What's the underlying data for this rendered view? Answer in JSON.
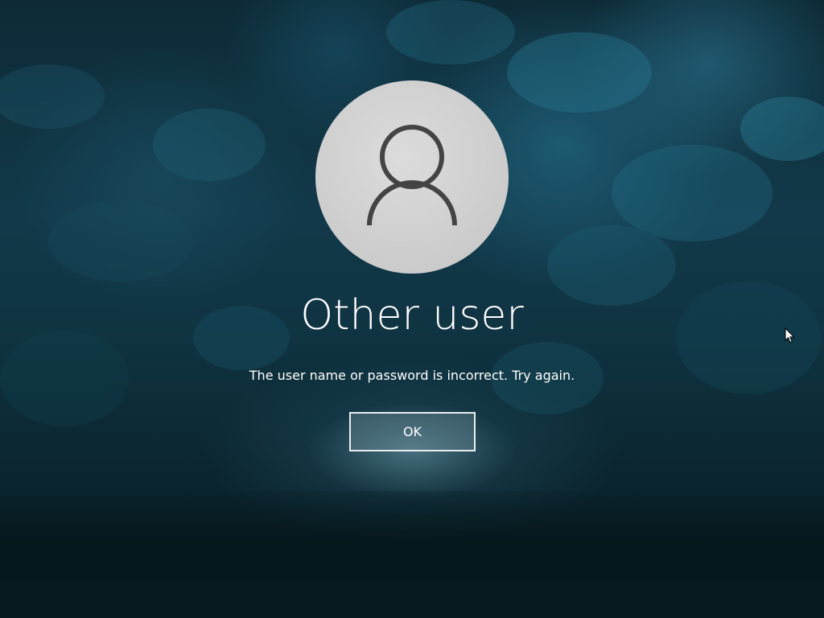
{
  "user_tile": {
    "icon": "user-avatar-icon",
    "name": "Other user"
  },
  "error": {
    "message": "The user name or password is incorrect. Try again."
  },
  "actions": {
    "ok_label": "OK"
  },
  "colors": {
    "background_dark": "#0b2630",
    "background_accent": "#2a7f9a",
    "avatar_circle": "#d3d3d3",
    "avatar_glyph": "#444444",
    "text": "#ffffff",
    "button_border": "#e8eef0"
  },
  "pointer": {
    "icon": "mouse-pointer-icon"
  }
}
